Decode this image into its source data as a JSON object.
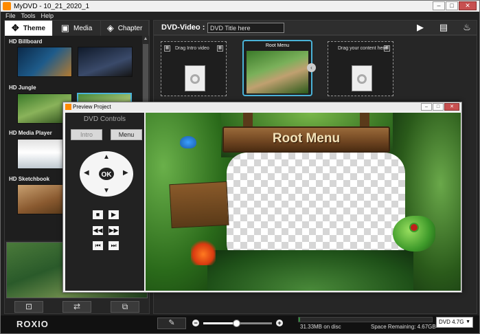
{
  "window": {
    "title": "MyDVD - 10_21_2020_1",
    "buttons": {
      "minimize": "–",
      "maximize": "□",
      "close": "✕"
    }
  },
  "menubar": {
    "items": [
      "File",
      "Tools",
      "Help"
    ]
  },
  "left_panel": {
    "tabs": [
      {
        "label": "Theme",
        "icon": "theme-icon",
        "active": true
      },
      {
        "label": "Media",
        "icon": "film-icon",
        "active": false
      },
      {
        "label": "Chapter",
        "icon": "layers-icon",
        "active": false
      }
    ],
    "theme_groups": [
      {
        "label": "HD Billboard"
      },
      {
        "label": "HD Jungle"
      },
      {
        "label": "HD Media Player"
      },
      {
        "label": "HD Sketchbook"
      }
    ],
    "bottom_buttons": [
      "add-icon",
      "swap-icon",
      "add-copy-icon"
    ]
  },
  "dvd_bar": {
    "label": "DVD-Video :",
    "title_value": "DVD Title here",
    "icons": [
      "play-icon",
      "save-icon",
      "burn-icon"
    ]
  },
  "canvas": {
    "intro_slot": {
      "label": "Drag Intro video"
    },
    "root_slot": {
      "label": "Root Menu"
    },
    "content_slot": {
      "label": "Drag your content here"
    },
    "link_glyph": "‹"
  },
  "preview": {
    "title": "Preview Project",
    "controls": {
      "title": "DVD Controls",
      "intro_label": "Intro",
      "menu_label": "Menu",
      "ok_label": "OK"
    },
    "scene_title": "Root Menu"
  },
  "bottom_bar": {
    "brand": "ROXIO",
    "disk_used": "31.33MB on disc",
    "space_remaining": "Space Remaining: 4.67GB",
    "disk_type": "DVD 4.7G",
    "zoom_level": 0.48,
    "disk_fill": 0.01
  }
}
